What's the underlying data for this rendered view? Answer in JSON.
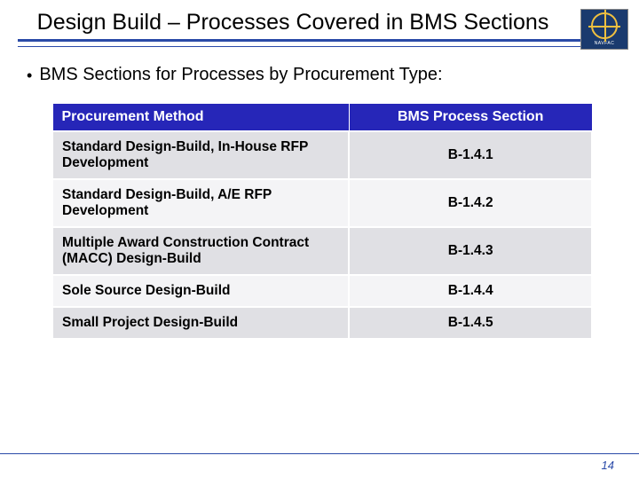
{
  "header": {
    "title": "Design Build – Processes Covered in BMS Sections",
    "logo_label": "NAVFAC"
  },
  "bullet": "BMS Sections for Processes by Procurement Type:",
  "table": {
    "headers": [
      "Procurement Method",
      "BMS Process Section"
    ],
    "rows": [
      {
        "method": "Standard Design-Build, In-House RFP Development",
        "section": "B-1.4.1"
      },
      {
        "method": "Standard Design-Build, A/E RFP Development",
        "section": "B-1.4.2"
      },
      {
        "method": "Multiple Award Construction Contract (MACC) Design-Build",
        "section": "B-1.4.3"
      },
      {
        "method": "Sole Source Design-Build",
        "section": "B-1.4.4"
      },
      {
        "method": "Small Project Design-Build",
        "section": "B-1.4.5"
      }
    ]
  },
  "page_number": "14"
}
